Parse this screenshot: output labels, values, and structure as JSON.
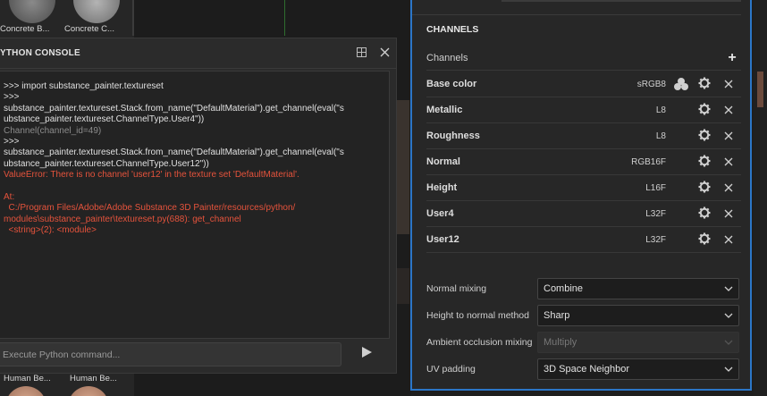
{
  "shelf": {
    "top_items": [
      {
        "label": "Concrete B..."
      },
      {
        "label": "Concrete C..."
      }
    ],
    "bottom_items": [
      {
        "label": "Human Be..."
      },
      {
        "label": "Human Be..."
      }
    ]
  },
  "console": {
    "title": "YTHON CONSOLE",
    "lines": [
      {
        "kind": "in",
        "text": ">>> import substance_painter.textureset"
      },
      {
        "kind": "in",
        "text": ">>>"
      },
      {
        "kind": "in",
        "text": "substance_painter.textureset.Stack.from_name(\"DefaultMaterial\").get_channel(eval(\"s"
      },
      {
        "kind": "in",
        "text": "ubstance_painter.textureset.ChannelType.User4\"))"
      },
      {
        "kind": "out",
        "text": "Channel(channel_id=49)"
      },
      {
        "kind": "in",
        "text": ">>>"
      },
      {
        "kind": "in",
        "text": "substance_painter.textureset.Stack.from_name(\"DefaultMaterial\").get_channel(eval(\"s"
      },
      {
        "kind": "in",
        "text": "ubstance_painter.textureset.ChannelType.User12\"))"
      },
      {
        "kind": "err",
        "text": "ValueError: There is no channel 'user12' in the texture set 'DefaultMaterial'."
      },
      {
        "kind": "err",
        "text": ""
      },
      {
        "kind": "err",
        "text": "At:"
      },
      {
        "kind": "err",
        "text": "  C:/Program Files/Adobe/Adobe Substance 3D Painter/resources/python/"
      },
      {
        "kind": "err",
        "text": "modules\\substance_painter\\textureset.py(688): get_channel"
      },
      {
        "kind": "err",
        "text": "  <string>(2): <module>"
      }
    ],
    "input_placeholder": "Execute Python command...",
    "icons": {
      "dock": "dock-icon",
      "close": "close-icon",
      "run": "play-icon"
    }
  },
  "panel": {
    "section_title": "CHANNELS",
    "channels_label": "Channels",
    "channels": [
      {
        "name": "Base color",
        "format": "sRGB8",
        "extra": "color-profile-icon"
      },
      {
        "name": "Metallic",
        "format": "L8"
      },
      {
        "name": "Roughness",
        "format": "L8"
      },
      {
        "name": "Normal",
        "format": "RGB16F"
      },
      {
        "name": "Height",
        "format": "L16F"
      },
      {
        "name": "User4",
        "format": "L32F"
      },
      {
        "name": "User12",
        "format": "L32F"
      }
    ],
    "settings": [
      {
        "label": "Normal mixing",
        "value": "Combine",
        "enabled": true
      },
      {
        "label": "Height to normal method",
        "value": "Sharp",
        "enabled": true
      },
      {
        "label": "Ambient occlusion mixing",
        "value": "Multiply",
        "enabled": false
      },
      {
        "label": "UV padding",
        "value": "3D Space Neighbor",
        "enabled": true
      }
    ]
  },
  "colors": {
    "accent_border": "#2b76c8",
    "error_text": "#e5533c",
    "output_text": "#8c8c8c"
  }
}
